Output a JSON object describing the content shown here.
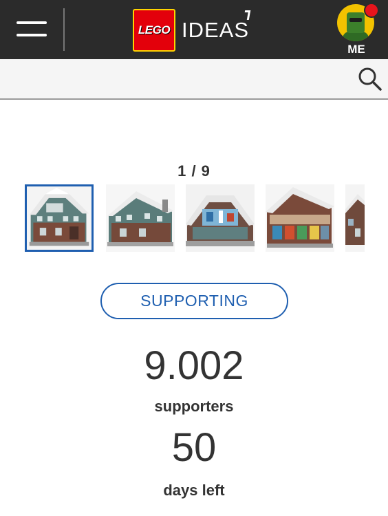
{
  "header": {
    "logo_text": "LEGO",
    "brand_name": "IDEAS",
    "user_label": "ME"
  },
  "gallery": {
    "counter": "1 / 9",
    "current_index": 1,
    "total": 9
  },
  "support": {
    "button_label": "SUPPORTING"
  },
  "stats": {
    "supporters_count": "9.002",
    "supporters_label": "supporters",
    "days_count": "50",
    "days_label": "days left"
  },
  "colors": {
    "header_bg": "#2b2b2b",
    "accent_blue": "#1f5fb0",
    "lego_red": "#e3000b",
    "notification_red": "#e8141c"
  }
}
